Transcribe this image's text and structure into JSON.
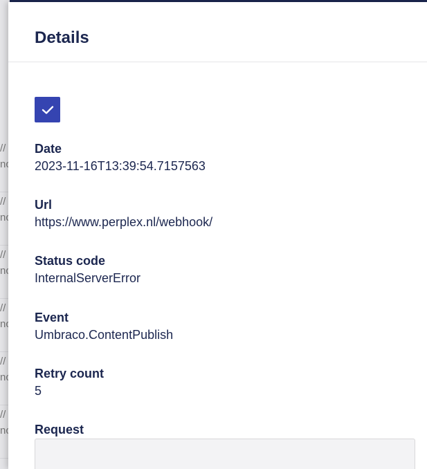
{
  "panel": {
    "title": "Details",
    "selected_checkbox": {
      "checked": true,
      "icon": "check-icon",
      "color": "#3544b1"
    }
  },
  "fields": {
    "date": {
      "label": "Date",
      "value": "2023-11-16T13:39:54.7157563"
    },
    "url": {
      "label": "Url",
      "value": "https://www.perplex.nl/webhook/"
    },
    "status_code": {
      "label": "Status code",
      "value": "InternalServerError"
    },
    "event": {
      "label": "Event",
      "value": "Umbraco.ContentPublish"
    },
    "retry_count": {
      "label": "Retry count",
      "value": "5"
    },
    "request": {
      "label": "Request",
      "value": ""
    }
  },
  "background_list": {
    "rows": [
      {
        "line1": "//",
        "line2": "nc"
      },
      {
        "line1": "//",
        "line2": "nc"
      },
      {
        "line1": "//",
        "line2": "nc"
      },
      {
        "line1": "//",
        "line2": "nc"
      },
      {
        "line1": "//",
        "line2": "nc"
      },
      {
        "line1": "//",
        "line2": "nc"
      }
    ]
  },
  "colors": {
    "accent": "#3544b1",
    "text": "#1b264f",
    "top_strip": "#1b264f"
  }
}
